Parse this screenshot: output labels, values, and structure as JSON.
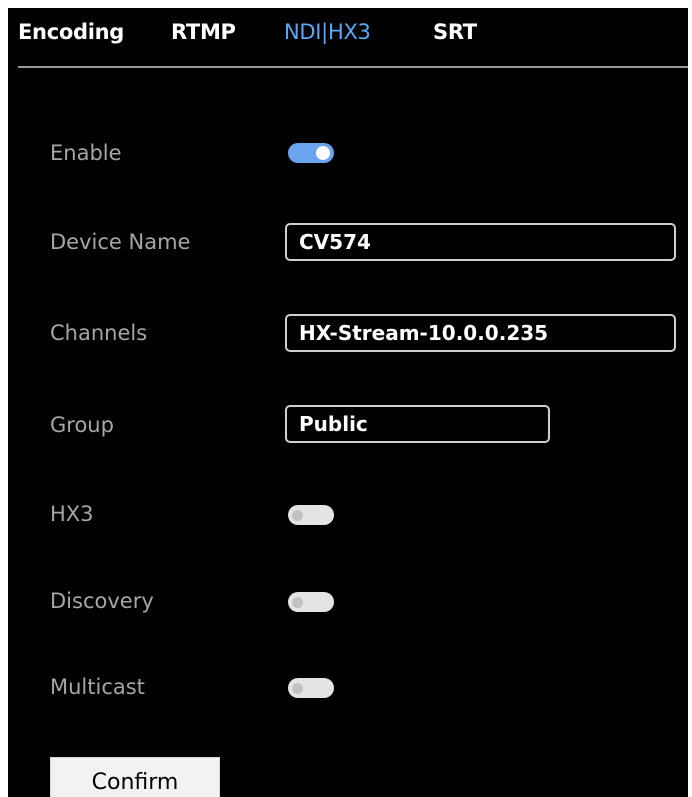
{
  "tabs": [
    {
      "label": "Encoding",
      "active": false
    },
    {
      "label": "RTMP",
      "active": false
    },
    {
      "label": "NDI|HX3",
      "active": true
    },
    {
      "label": "SRT",
      "active": false
    }
  ],
  "colors": {
    "background": "#000000",
    "active_tab": "#5aa9f5",
    "label": "#a6a6a6",
    "toggle_on": "#6aa3ee",
    "toggle_off": "#e4e4e4"
  },
  "form": {
    "enable": {
      "label": "Enable",
      "state": "on"
    },
    "device_name": {
      "label": "Device Name",
      "value": "CV574"
    },
    "channels": {
      "label": "Channels",
      "value": "HX-Stream-10.0.0.235"
    },
    "group": {
      "label": "Group",
      "value": "Public"
    },
    "hx3": {
      "label": "HX3",
      "state": "off"
    },
    "discovery": {
      "label": "Discovery",
      "state": "off"
    },
    "multicast": {
      "label": "Multicast",
      "state": "off"
    }
  },
  "confirm_label": "Confirm"
}
